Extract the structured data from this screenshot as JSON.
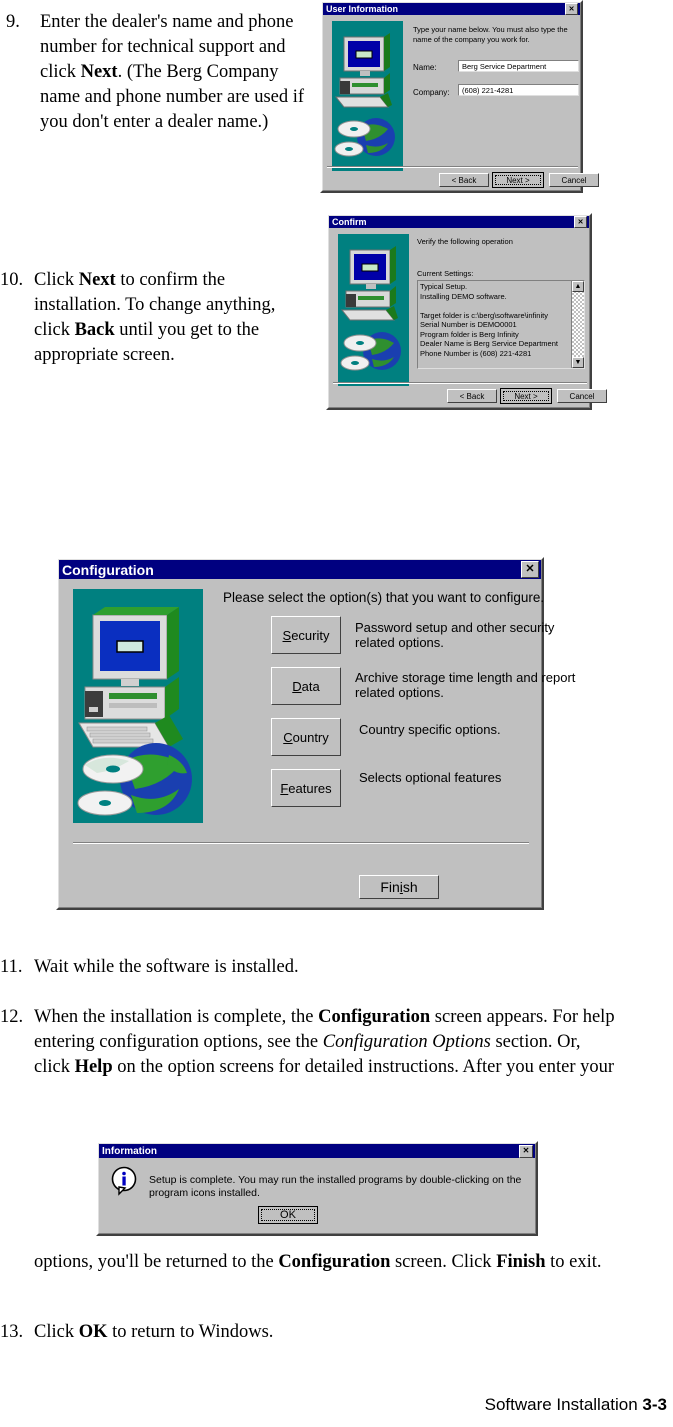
{
  "page": {
    "footer_text": "Software Installation ",
    "footer_page": "3-3"
  },
  "steps": [
    {
      "num": "9.",
      "parts": [
        {
          "t": "Enter the dealer's name and phone number for technical support and click ",
          "s": "n"
        },
        {
          "t": "Next",
          "s": "b"
        },
        {
          "t": ". (The Berg Company name and phone number are used if you don't enter a dealer name.)",
          "s": "n"
        }
      ]
    },
    {
      "num": "10.",
      "parts": [
        {
          "t": "Click ",
          "s": "n"
        },
        {
          "t": "Next",
          "s": "b"
        },
        {
          "t": " to confirm the installation. To change anything, click ",
          "s": "n"
        },
        {
          "t": "Back",
          "s": "b"
        },
        {
          "t": " until you get to the appropriate screen.",
          "s": "n"
        }
      ]
    },
    {
      "num": "11.",
      "parts": [
        {
          "t": "Wait while the software is installed.",
          "s": "n"
        }
      ]
    },
    {
      "num": "12.",
      "parts": [
        {
          "t": "When the installation is complete, the ",
          "s": "n"
        },
        {
          "t": "Configuration",
          "s": "b"
        },
        {
          "t": " screen appears. For help entering configuration options, see the ",
          "s": "n"
        },
        {
          "t": "Configuration Options",
          "s": "i"
        },
        {
          "t": " section. Or, click ",
          "s": "n"
        },
        {
          "t": "Help",
          "s": "b"
        },
        {
          "t": " on the option screens for detailed instructions. After you enter your",
          "s": "n"
        }
      ]
    },
    {
      "num": "",
      "parts": [
        {
          "t": "options, you'll be returned to the ",
          "s": "n"
        },
        {
          "t": "Configuration",
          "s": "b"
        },
        {
          "t": " screen. Click ",
          "s": "n"
        },
        {
          "t": "Finish",
          "s": "b"
        },
        {
          "t": " to exit.",
          "s": "n"
        }
      ]
    },
    {
      "num": "13.",
      "parts": [
        {
          "t": "Click ",
          "s": "n"
        },
        {
          "t": "OK",
          "s": "b"
        },
        {
          "t": " to return to Windows.",
          "s": "n"
        }
      ]
    }
  ],
  "user_info_dialog": {
    "title": "User Information",
    "close_label": "✕",
    "prompt": "Type your name below. You must also type the name of the company you work for.",
    "name_label": "Name:",
    "name_value": "Berg Service Department",
    "company_label": "Company:",
    "company_value": "(608) 221-4281",
    "back_button": "< Back",
    "next_button": "Next >",
    "cancel_button": "Cancel"
  },
  "confirm_dialog": {
    "title": "Confirm",
    "close_label": "✕",
    "prompt": "Verify the following operation",
    "settings_label": "Current Settings:",
    "settings_lines": [
      "Typical Setup.",
      "Installing DEMO software.",
      "",
      "Target folder is c:\\berg\\software\\infinity",
      "Serial Number is DEMO0001",
      "Program folder is Berg Infinity",
      "Dealer Name is Berg Service Department",
      "Phone Number is (608) 221-4281"
    ],
    "scroll_up": "▲",
    "scroll_down": "▼",
    "back_button": "< Back",
    "next_button": "Next >",
    "cancel_button": "Cancel"
  },
  "configuration_dialog": {
    "title": "Configuration",
    "close_label": "✕",
    "prompt": "Please select the option(s) that you want to configure.",
    "options": [
      {
        "button": "Security",
        "accel": "S",
        "desc": "Password setup and other security related options."
      },
      {
        "button": "Data",
        "accel": "D",
        "desc": "Archive storage time length and report related options."
      },
      {
        "button": "Country",
        "accel": "C",
        "desc": "Country specific options."
      },
      {
        "button": "Features",
        "accel": "F",
        "desc": "Selects optional features"
      }
    ],
    "finish_button": "Finish"
  },
  "information_dialog": {
    "title": "Information",
    "close_label": "✕",
    "icon": "info-icon",
    "message": "Setup is complete. You may run the installed programs by double-clicking on the program icons installed.",
    "ok_button": "OK"
  }
}
